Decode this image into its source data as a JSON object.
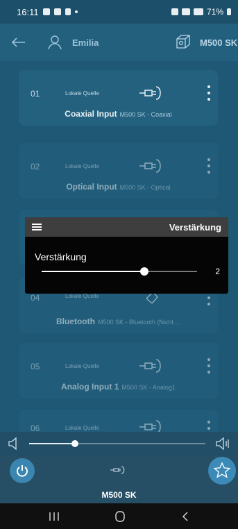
{
  "status": {
    "time": "16:11",
    "battery": "71%"
  },
  "header": {
    "user": "Emilia",
    "device": "M500 SK"
  },
  "sources": [
    {
      "num": "01",
      "src": "Lokale Quelle",
      "name": "Coaxial Input",
      "desc": "M500 SK - Coaxial",
      "icon": "cable-plug-icon"
    },
    {
      "num": "02",
      "src": "Lokale Quelle",
      "name": "Optical Input",
      "desc": "M500 SK - Optical",
      "icon": "cable-plug-icon"
    },
    {
      "num": "04",
      "src": "Lokale Quelle",
      "name": "Bluetooth",
      "desc": "M500 SK - Bluetooth (Nicht ...",
      "icon": "bluetooth-icon"
    },
    {
      "num": "05",
      "src": "Lokale Quelle",
      "name": "Analog Input 1",
      "desc": "M500 SK - Analog1",
      "icon": "cable-plug-icon"
    },
    {
      "num": "06",
      "src": "Lokale Quelle",
      "icon": "cable-plug-icon"
    }
  ],
  "gain_dialog": {
    "title": "Verstärkung",
    "label": "Verstärkung",
    "value": "2",
    "level": 0.66
  },
  "volume": {
    "level": 0.26
  },
  "player": {
    "device": "M500 SK"
  },
  "colors": {
    "accent": "#3a86b0",
    "background": "#1f5874"
  }
}
